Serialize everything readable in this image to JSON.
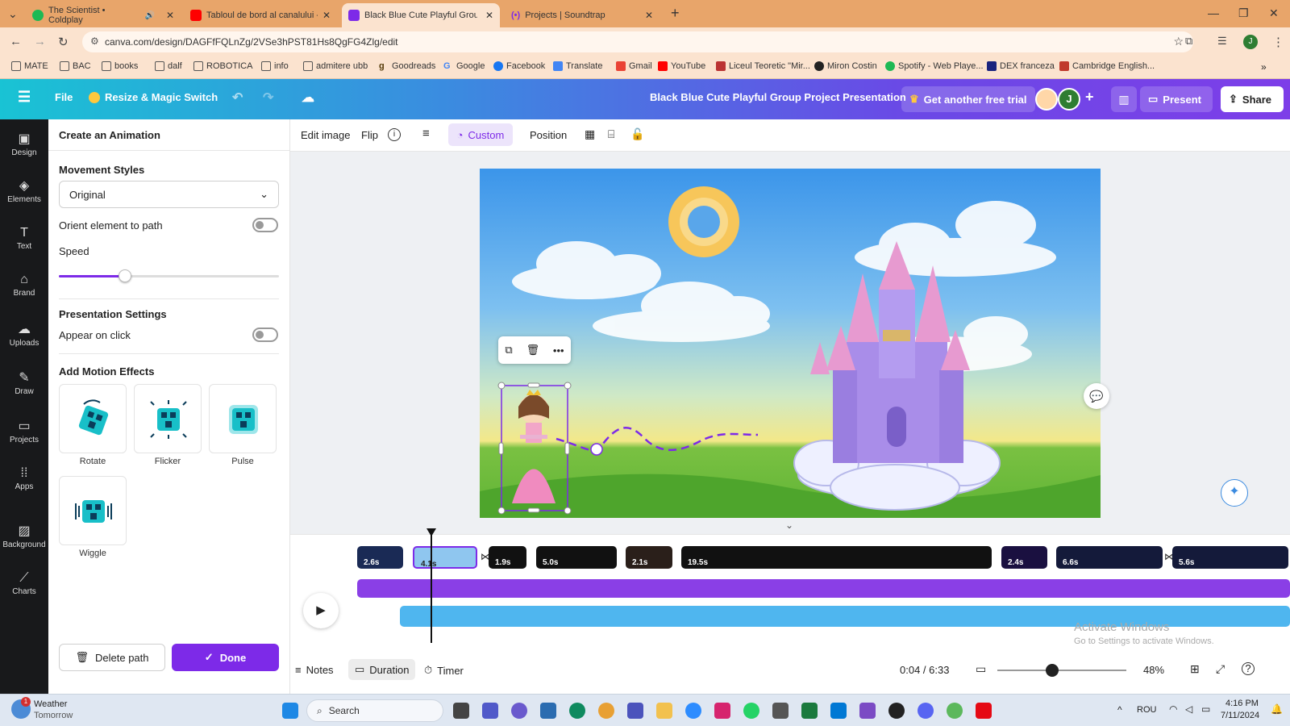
{
  "browser": {
    "tabs": [
      {
        "title": "The Scientist • Coldplay",
        "favicon_color": "#1db954"
      },
      {
        "title": "Tabloul de bord al canalului - Yo",
        "favicon_color": "#ff0000"
      },
      {
        "title": "Black Blue Cute Playful Group P",
        "favicon_color": "#7d2ae8"
      },
      {
        "title": "Projects | Soundtrap",
        "favicon_color": "#7d2ae8"
      }
    ],
    "url": "canva.com/design/DAGFfFQLnZg/2VSe3hPST81Hs8QgFG4Zlg/edit",
    "bookmarks": [
      "MATE",
      "BAC",
      "books",
      "dalf",
      "ROBOTICA",
      "info",
      "admitere ubb",
      "Goodreads",
      "Google",
      "Facebook",
      "Translate",
      "Gmail",
      "YouTube",
      "Liceul Teoretic \"Mir...",
      "Miron Costin",
      "Spotify - Web Playe...",
      "DEX franceza",
      "Cambridge English..."
    ]
  },
  "header": {
    "file": "File",
    "resize": "Resize & Magic Switch",
    "doc_title": "Black Blue Cute Playful Group Project Presentation",
    "trial": "Get another free trial",
    "avatar_letter": "J",
    "present": "Present",
    "share": "Share"
  },
  "rail": [
    "Design",
    "Elements",
    "Text",
    "Brand",
    "Uploads",
    "Draw",
    "Projects",
    "Apps",
    "Background",
    "Charts"
  ],
  "panel": {
    "title": "Create an Animation",
    "movement_heading": "Movement Styles",
    "movement_value": "Original",
    "orient_label": "Orient element to path",
    "speed_label": "Speed",
    "speed_value": 0.3,
    "presentation_heading": "Presentation Settings",
    "appear_label": "Appear on click",
    "effects_heading": "Add Motion Effects",
    "effects": [
      "Rotate",
      "Flicker",
      "Pulse",
      "Wiggle"
    ],
    "delete_path": "Delete path",
    "done": "Done"
  },
  "toolbar": {
    "edit_image": "Edit image",
    "flip": "Flip",
    "custom": "Custom",
    "position": "Position"
  },
  "timeline": {
    "clips": [
      "2.6s",
      "4.1s",
      "1.9s",
      "5.0s",
      "2.1s",
      "19.5s",
      "2.4s",
      "6.6s",
      "5.6s"
    ],
    "time": "0:04 / 6:33",
    "zoom": "48%",
    "notes": "Notes",
    "duration": "Duration",
    "timer": "Timer",
    "activate_title": "Activate Windows",
    "activate_sub": "Go to Settings to activate Windows."
  },
  "taskbar": {
    "weather_title": "Weather",
    "weather_sub": "Tomorrow",
    "badge": "1",
    "search": "Search",
    "lang": "ROU",
    "time": "4:16 PM",
    "date": "7/11/2024"
  },
  "colors": {
    "accent": "#7d2ae8",
    "teal": "#00c4cc"
  }
}
